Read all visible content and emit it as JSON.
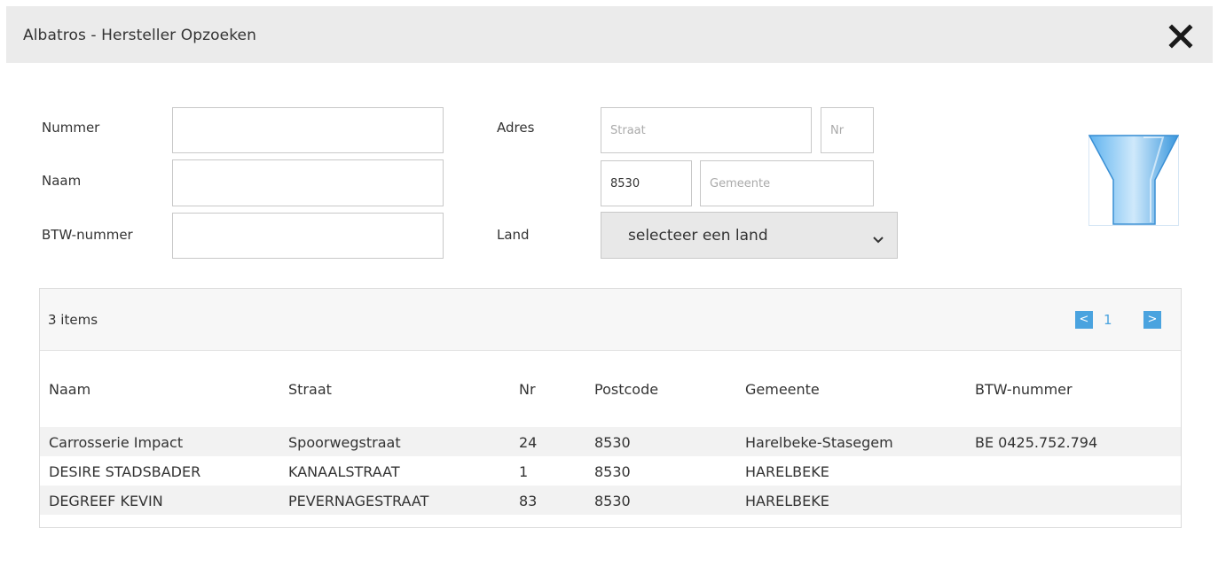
{
  "dialog": {
    "title": "Albatros - Hersteller Opzoeken"
  },
  "form": {
    "nummer_label": "Nummer",
    "nummer_value": "",
    "naam_label": "Naam",
    "naam_value": "",
    "btw_label": "BTW-nummer",
    "btw_value": "",
    "adres_label": "Adres",
    "straat_placeholder": "Straat",
    "straat_value": "",
    "nr_placeholder": "Nr",
    "nr_value": "",
    "postcode_value": "8530",
    "gemeente_placeholder": "Gemeente",
    "gemeente_value": "",
    "land_label": "Land",
    "land_selected": "selecteer een land"
  },
  "results": {
    "count_text": "3 items",
    "page_prev": "<",
    "page_current": "1",
    "page_next": ">",
    "columns": [
      "Naam",
      "Straat",
      "Nr",
      "Postcode",
      "Gemeente",
      "BTW-nummer"
    ],
    "rows": [
      [
        "Carrosserie Impact",
        "Spoorwegstraat",
        "24",
        "8530",
        "Harelbeke-Stasegem",
        "BE 0425.752.794"
      ],
      [
        "DESIRE STADSBADER",
        "KANAALSTRAAT",
        "1",
        "8530",
        "HARELBEKE",
        ""
      ],
      [
        "DEGREEF KEVIN",
        "PEVERNAGESTRAAT",
        "83",
        "8530",
        "HARELBEKE",
        ""
      ]
    ]
  },
  "icons": {
    "close": "close-icon",
    "filter": "filter-funnel-icon",
    "dropdown": "chevron-down-icon"
  },
  "colors": {
    "titlebar": "#ebebeb",
    "accent": "#4aa3df",
    "funnel": "#8ec9f5"
  }
}
